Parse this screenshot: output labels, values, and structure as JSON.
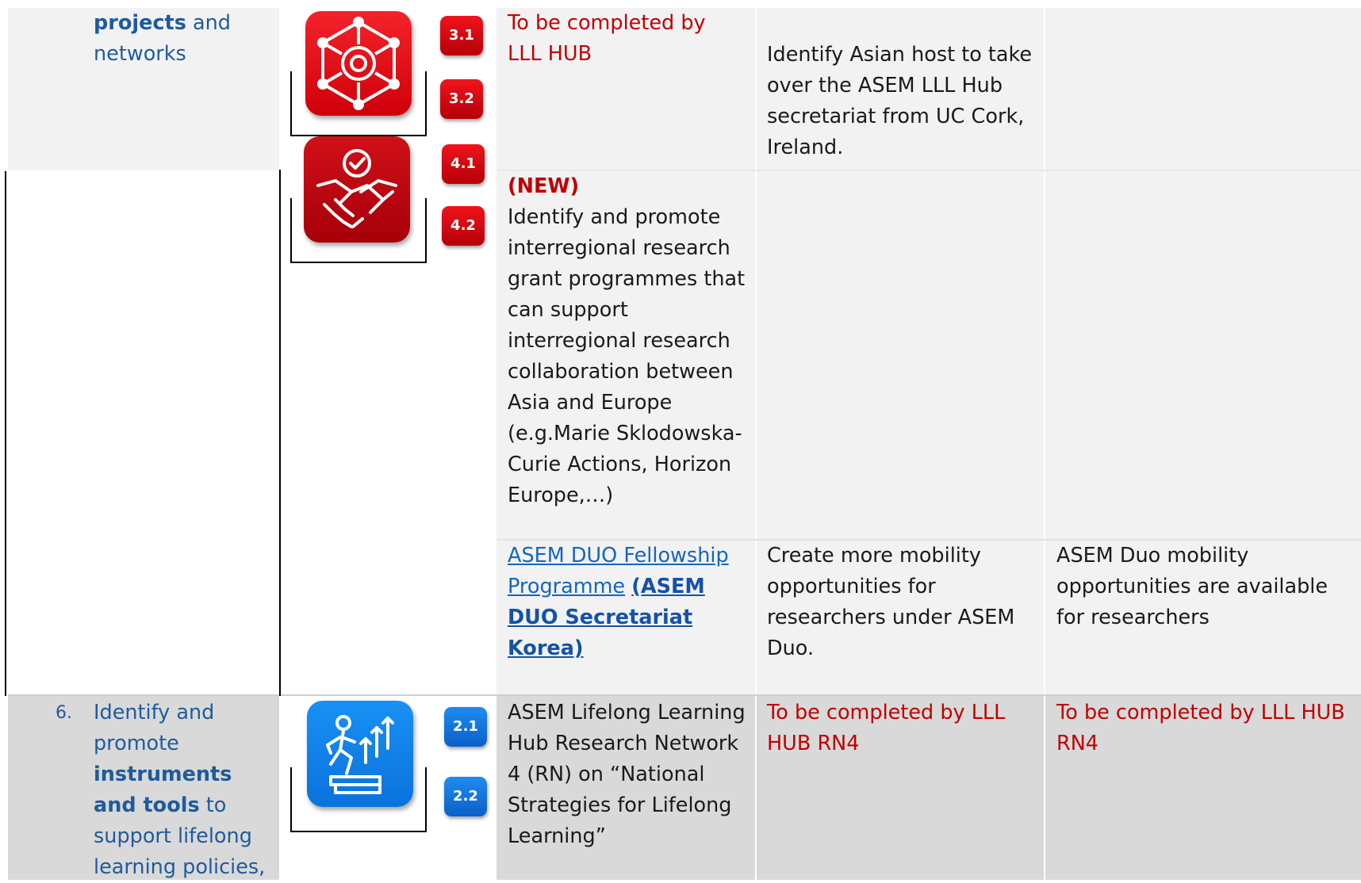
{
  "row_networks": {
    "objective_bold": "projects",
    "objective_rest": " and",
    "objective_line2": "networks",
    "badges": [
      "3.1",
      "3.2",
      "4.1",
      "4.2"
    ],
    "activity1": "To be completed by LLL HUB",
    "expected1": "Identify Asian host to take over the ASEM LLL Hub secretariat from UC Cork, Ireland.",
    "new_tag": "(NEW)",
    "activity2": "Identify and promote interregional research grant programmes that can support interregional research collaboration between Asia and Europe (e.g.Marie Sklodowska-Curie Actions, Horizon Europe,…)",
    "activity3_link": "ASEM DUO Fellowship Programme",
    "activity3_org": "(ASEM DUO Secretariat Korea)",
    "expected3": "Create more mobility opportunities for researchers under ASEM Duo.",
    "result3": "ASEM Duo mobility opportunities are available for researchers"
  },
  "row_6": {
    "number": "6.",
    "objective_1": "Identify and promote",
    "objective_bold": "instruments and tools",
    "objective_2": "to support lifelong learning policies,",
    "badges": [
      "2.1",
      "2.2"
    ],
    "activity": "ASEM Lifelong Learning Hub Research Network 4 (RN) on “National Strategies for Lifelong Learning”",
    "expected": "To be completed by LLL HUB RN4",
    "result": "To be completed by LLL HUB RN4"
  },
  "colors": {
    "accent_blue": "#1f5b9b",
    "alert_red": "#c00000",
    "icon_red": "#e30613",
    "icon_blue": "#0a84e8"
  },
  "icons": [
    "network-gear-icon",
    "handshake-check-icon",
    "climbing-growth-icon"
  ]
}
